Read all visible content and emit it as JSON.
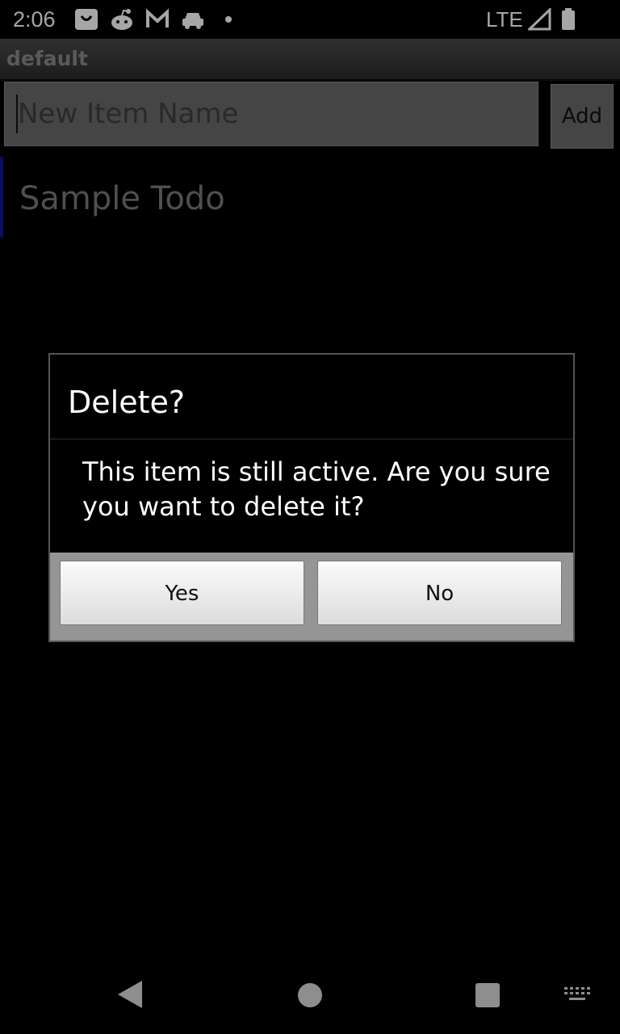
{
  "status_bar": {
    "time": "2:06",
    "network": "LTE",
    "icons": [
      "shopping-bag-icon",
      "reddit-icon",
      "gmail-icon",
      "car-icon",
      "notification-dot-icon",
      "signal-icon",
      "battery-icon"
    ]
  },
  "app": {
    "title": "default"
  },
  "input": {
    "placeholder": "New Item Name",
    "value": ""
  },
  "add_button": {
    "label": "Add"
  },
  "list": {
    "items": [
      {
        "label": "Sample Todo"
      }
    ]
  },
  "dialog": {
    "title": "Delete?",
    "message": "This item is still active. Are you sure you want to delete it?",
    "yes_label": "Yes",
    "no_label": "No"
  },
  "nav": {
    "icons": [
      "back-icon",
      "home-icon",
      "recent-apps-icon",
      "keyboard-icon"
    ]
  },
  "colors": {
    "list_marker": "#0c14a6",
    "title_bar": "#3a3a3a",
    "dialog_button_bar": "#959595"
  }
}
